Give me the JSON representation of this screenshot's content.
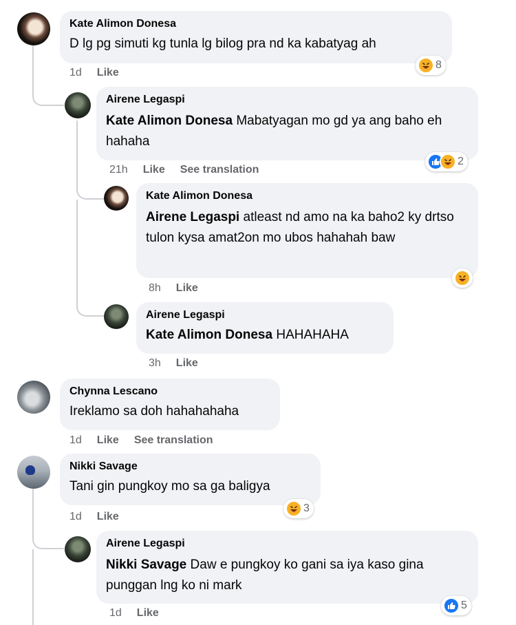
{
  "comments": [
    {
      "author": "Kate Alimon Donesa",
      "text": "D lg pg simuti kg tunla lg bilog pra nd ka kabatyag ah",
      "time": "1d",
      "like": "Like",
      "reactions": "8"
    },
    {
      "author": "Airene Legaspi",
      "mention": "Kate Alimon Donesa",
      "text": " Mabatyagan mo gd ya ang baho eh hahaha",
      "time": "21h",
      "like": "Like",
      "translate": "See translation",
      "reactions": "2"
    },
    {
      "author": "Kate Alimon Donesa",
      "mention": "Airene Legaspi",
      "text": " atleast nd amo na ka baho2 ky drtso tulon kysa amat2on mo ubos hahahah baw",
      "time": "8h",
      "like": "Like",
      "reactions": ""
    },
    {
      "author": "Airene Legaspi",
      "mention": "Kate Alimon Donesa",
      "text": " HAHAHAHA",
      "time": "3h",
      "like": "Like"
    },
    {
      "author": "Chynna Lescano",
      "text": "Ireklamo sa doh hahahahaha",
      "time": "1d",
      "like": "Like",
      "translate": "See translation"
    },
    {
      "author": "Nikki Savage",
      "text": "Tani gin pungkoy mo sa ga baligya",
      "time": "1d",
      "like": "Like",
      "reactions": "3"
    },
    {
      "author": "Airene Legaspi",
      "mention": "Nikki Savage",
      "text": " Daw e pungkoy ko gani sa iya kaso gina punggan lng ko ni mark",
      "time": "1d",
      "like": "Like",
      "reactions": "5"
    }
  ],
  "icons": {
    "haha": "haha-reaction-icon",
    "like": "like-reaction-icon"
  },
  "colors": {
    "bubble": "#f0f2f5",
    "meta": "#65676b",
    "like_blue": "#1877f2",
    "haha_yellow": "#f7b125"
  }
}
